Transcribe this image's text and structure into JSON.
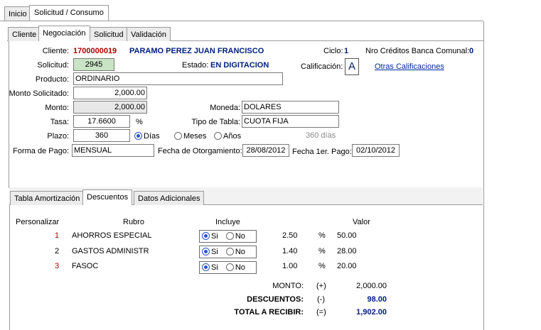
{
  "top_tabs": [
    "Inicio",
    "Solicitud  / Consumo"
  ],
  "sub_tabs": [
    "Cliente",
    "Negociación",
    "Solicitud",
    "Validación"
  ],
  "client": {
    "label": "Cliente:",
    "code": "1700000019",
    "name": "PARAMO PEREZ JUAN FRANCISCO",
    "ciclo_label": "Ciclo:",
    "ciclo": "1",
    "nro_label": "Nro Créditos Banca Comunal:",
    "nro": "0"
  },
  "solicitud": {
    "label": "Solicitud:",
    "value": "2945"
  },
  "estado": {
    "label": "Estado:",
    "value": "EN DIGITACION"
  },
  "calificacion": {
    "label": "Calificación:",
    "value": "A",
    "link": "Otras Calificaciones"
  },
  "producto": {
    "label": "Producto:",
    "value": "ORDINARIO"
  },
  "monto_solicitado": {
    "label": "Monto Solicitado:",
    "value": "2,000.00"
  },
  "monto": {
    "label": "Monto:",
    "value": "2,000.00"
  },
  "moneda": {
    "label": "Moneda:",
    "value": "DOLARES"
  },
  "tasa": {
    "label": "Tasa:",
    "value": "17.6600",
    "unit": "%"
  },
  "tipo_tabla": {
    "label": "Tipo de Tabla:",
    "value": "CUOTA FIJA"
  },
  "plazo": {
    "label": "Plazo:",
    "value": "360",
    "options": [
      "Días",
      "Meses",
      "Años"
    ],
    "selected": "Días",
    "hint": "360 días"
  },
  "forma_pago": {
    "label": "Forma de Pago:",
    "value": "MENSUAL"
  },
  "fecha_otorgamiento": {
    "label": "Fecha de Otorgamiento:",
    "value": "28/08/2012"
  },
  "fecha_primer_pago": {
    "label": "Fecha 1er. Pago:",
    "value": "02/10/2012"
  },
  "lower_tabs": [
    "Tabla Amortización",
    "Descuentos",
    "Datos Adicionales"
  ],
  "descuentos": {
    "headers": {
      "personalizar": "Personalizar",
      "rubro": "Rubro",
      "incluye": "Incluye",
      "valor": "Valor"
    },
    "yes_label": "Si",
    "no_label": "No",
    "rows": [
      {
        "num": "1",
        "rubro": "AHORROS ESPECIAL",
        "incluye": "Si",
        "pct": "2.50",
        "pct_sign": "%",
        "valor": "50.00"
      },
      {
        "num": "2",
        "rubro": "GASTOS ADMINISTR",
        "incluye": "Si",
        "pct": "1.40",
        "pct_sign": "%",
        "valor": "28.00"
      },
      {
        "num": "3",
        "rubro": "FASOC",
        "incluye": "Si",
        "pct": "1.00",
        "pct_sign": "%",
        "valor": "20.00"
      }
    ],
    "totals": [
      {
        "label": "MONTO:",
        "sign": "(+)",
        "value": "2,000.00"
      },
      {
        "label": "DESCUENTOS:",
        "sign": "(-)",
        "value": "98.00"
      },
      {
        "label": "TOTAL A RECIBIR:",
        "sign": "(=)",
        "value": "1,902.00"
      }
    ]
  }
}
